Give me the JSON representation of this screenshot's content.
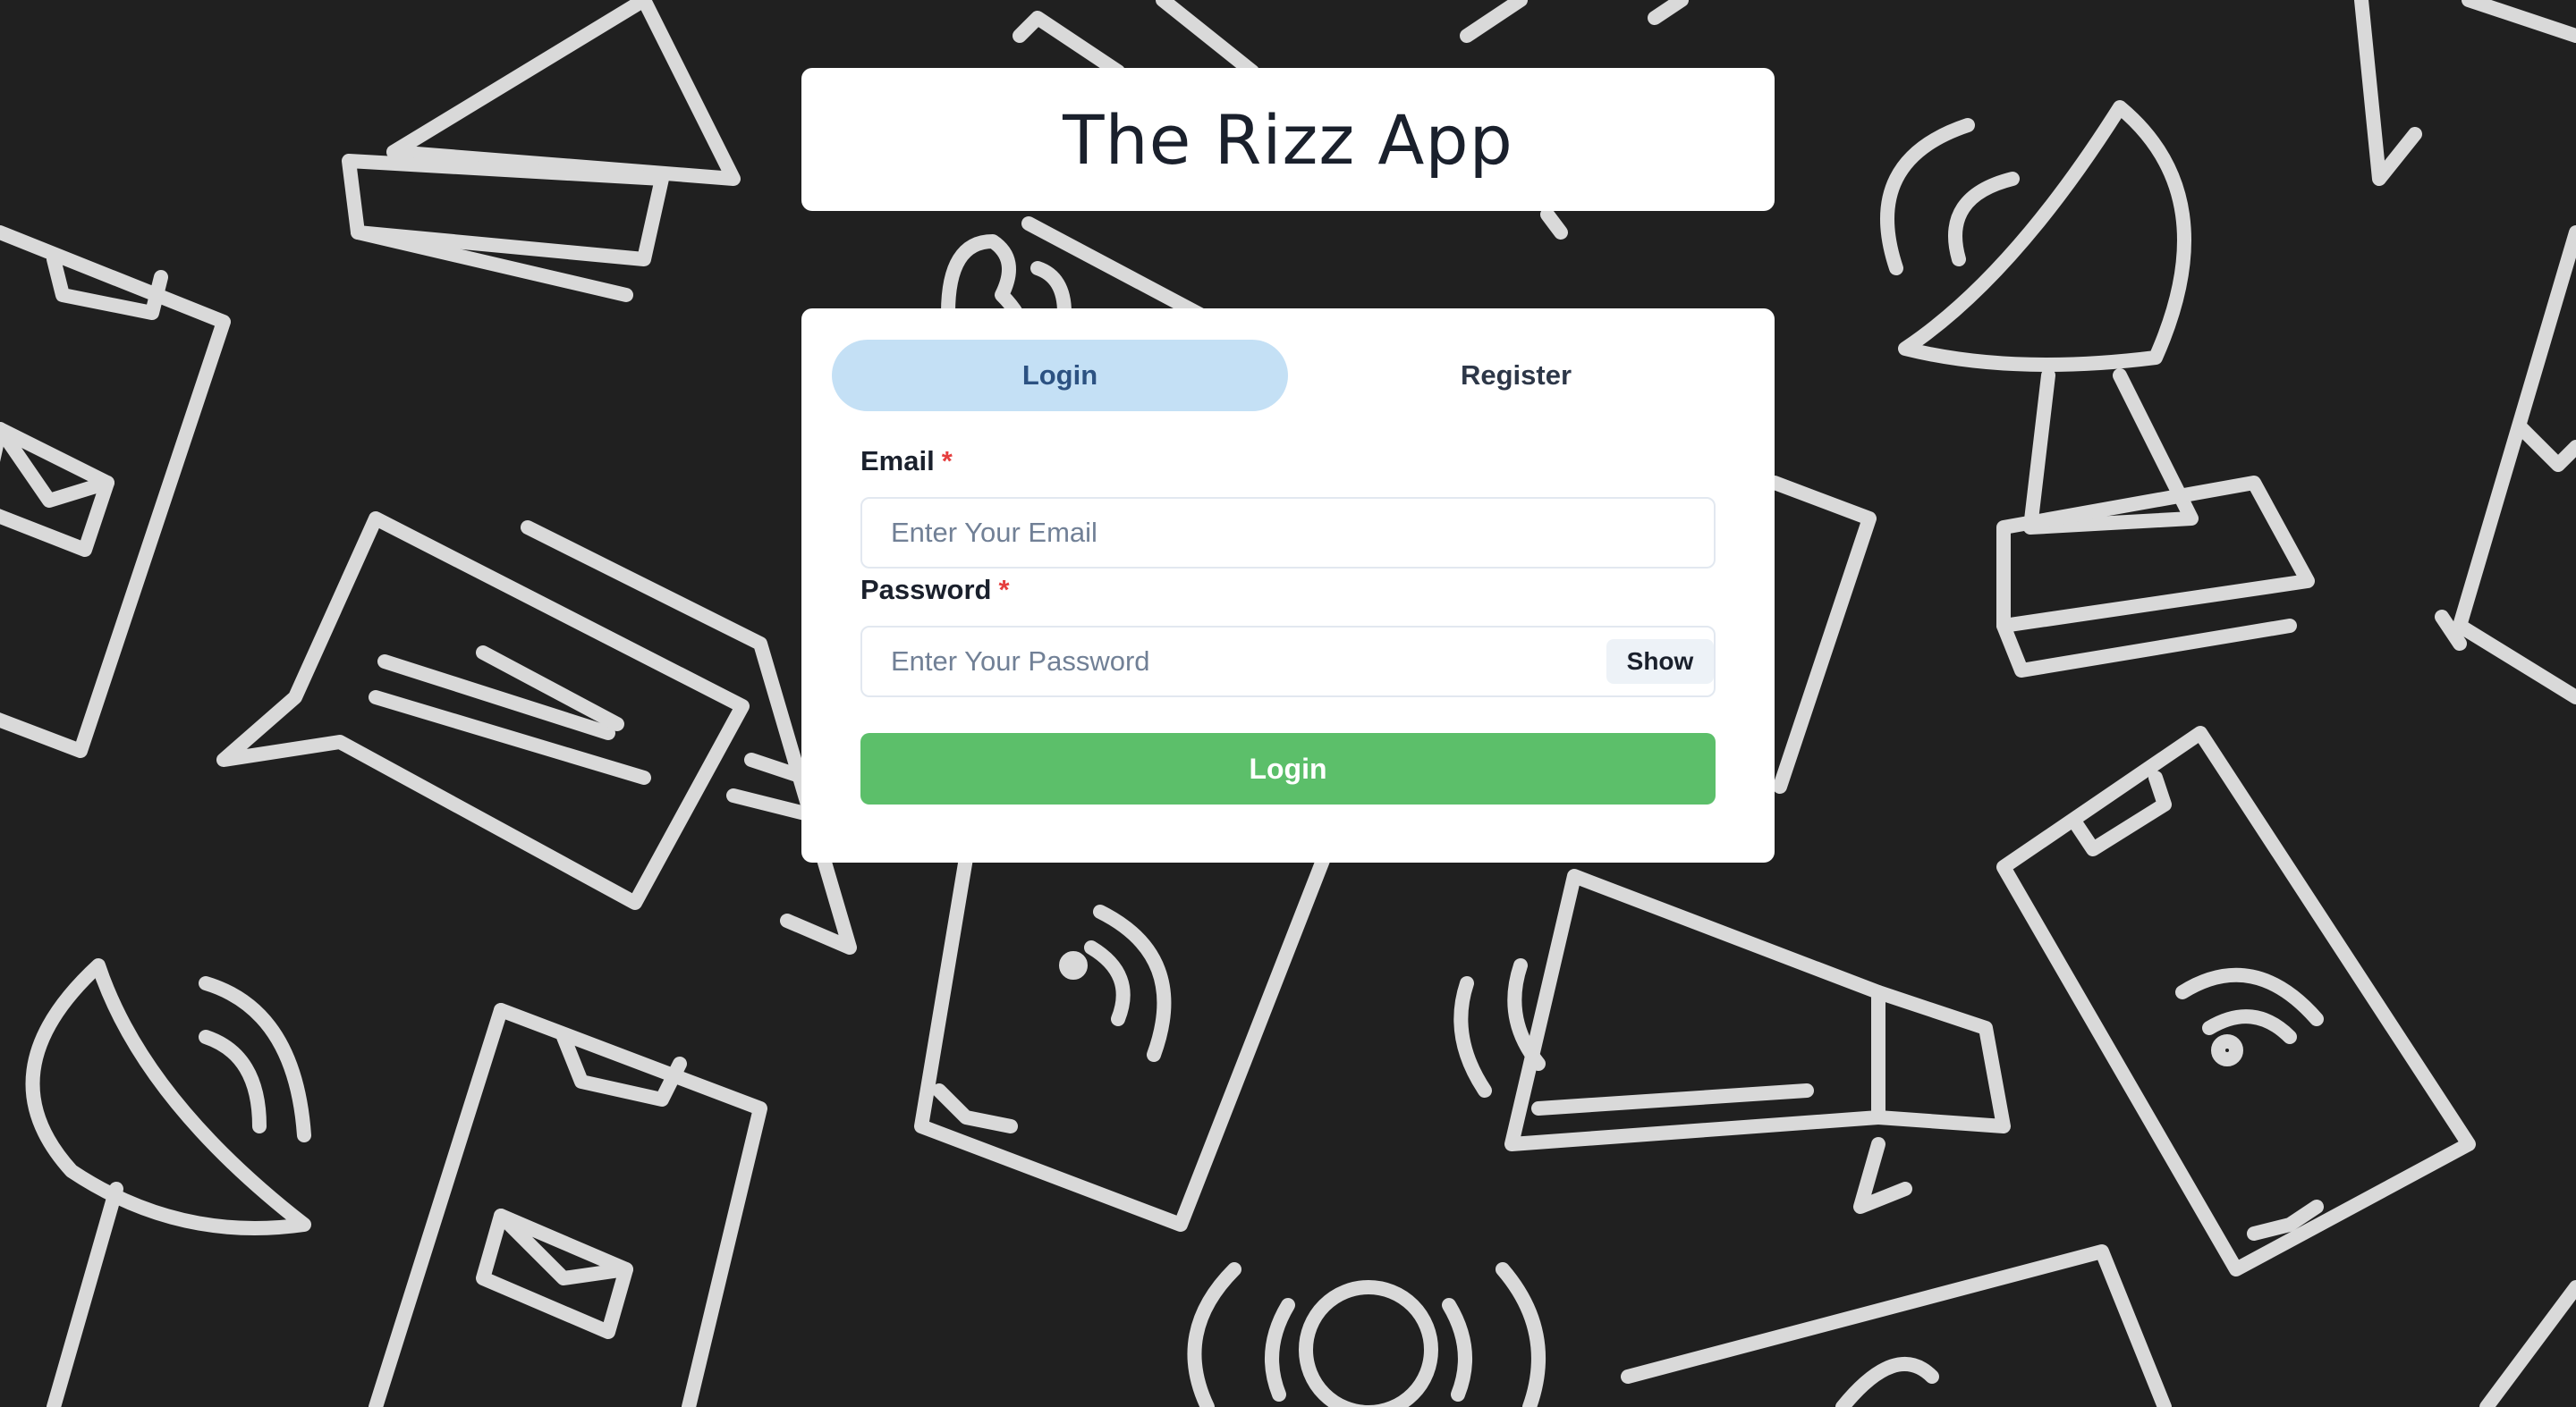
{
  "app": {
    "title": "The Rizz App"
  },
  "tabs": [
    {
      "label": "Login",
      "active": true
    },
    {
      "label": "Register",
      "active": false
    }
  ],
  "form": {
    "email_label": "Email",
    "email_placeholder": "Enter Your Email",
    "password_label": "Password",
    "password_placeholder": "Enter Your Password",
    "required_marker": "*",
    "show_label": "Show",
    "submit_label": "Login"
  },
  "colors": {
    "background": "#202020",
    "doodle": "#d9d9d9",
    "tab_active": "#c4e0f5",
    "submit": "#5cbf6a",
    "required": "#e53e3e"
  },
  "background_icons": [
    "satellite-dish-icon",
    "phone-icon",
    "envelope-icon",
    "chat-bubble-icon",
    "megaphone-icon",
    "wifi-icon"
  ]
}
